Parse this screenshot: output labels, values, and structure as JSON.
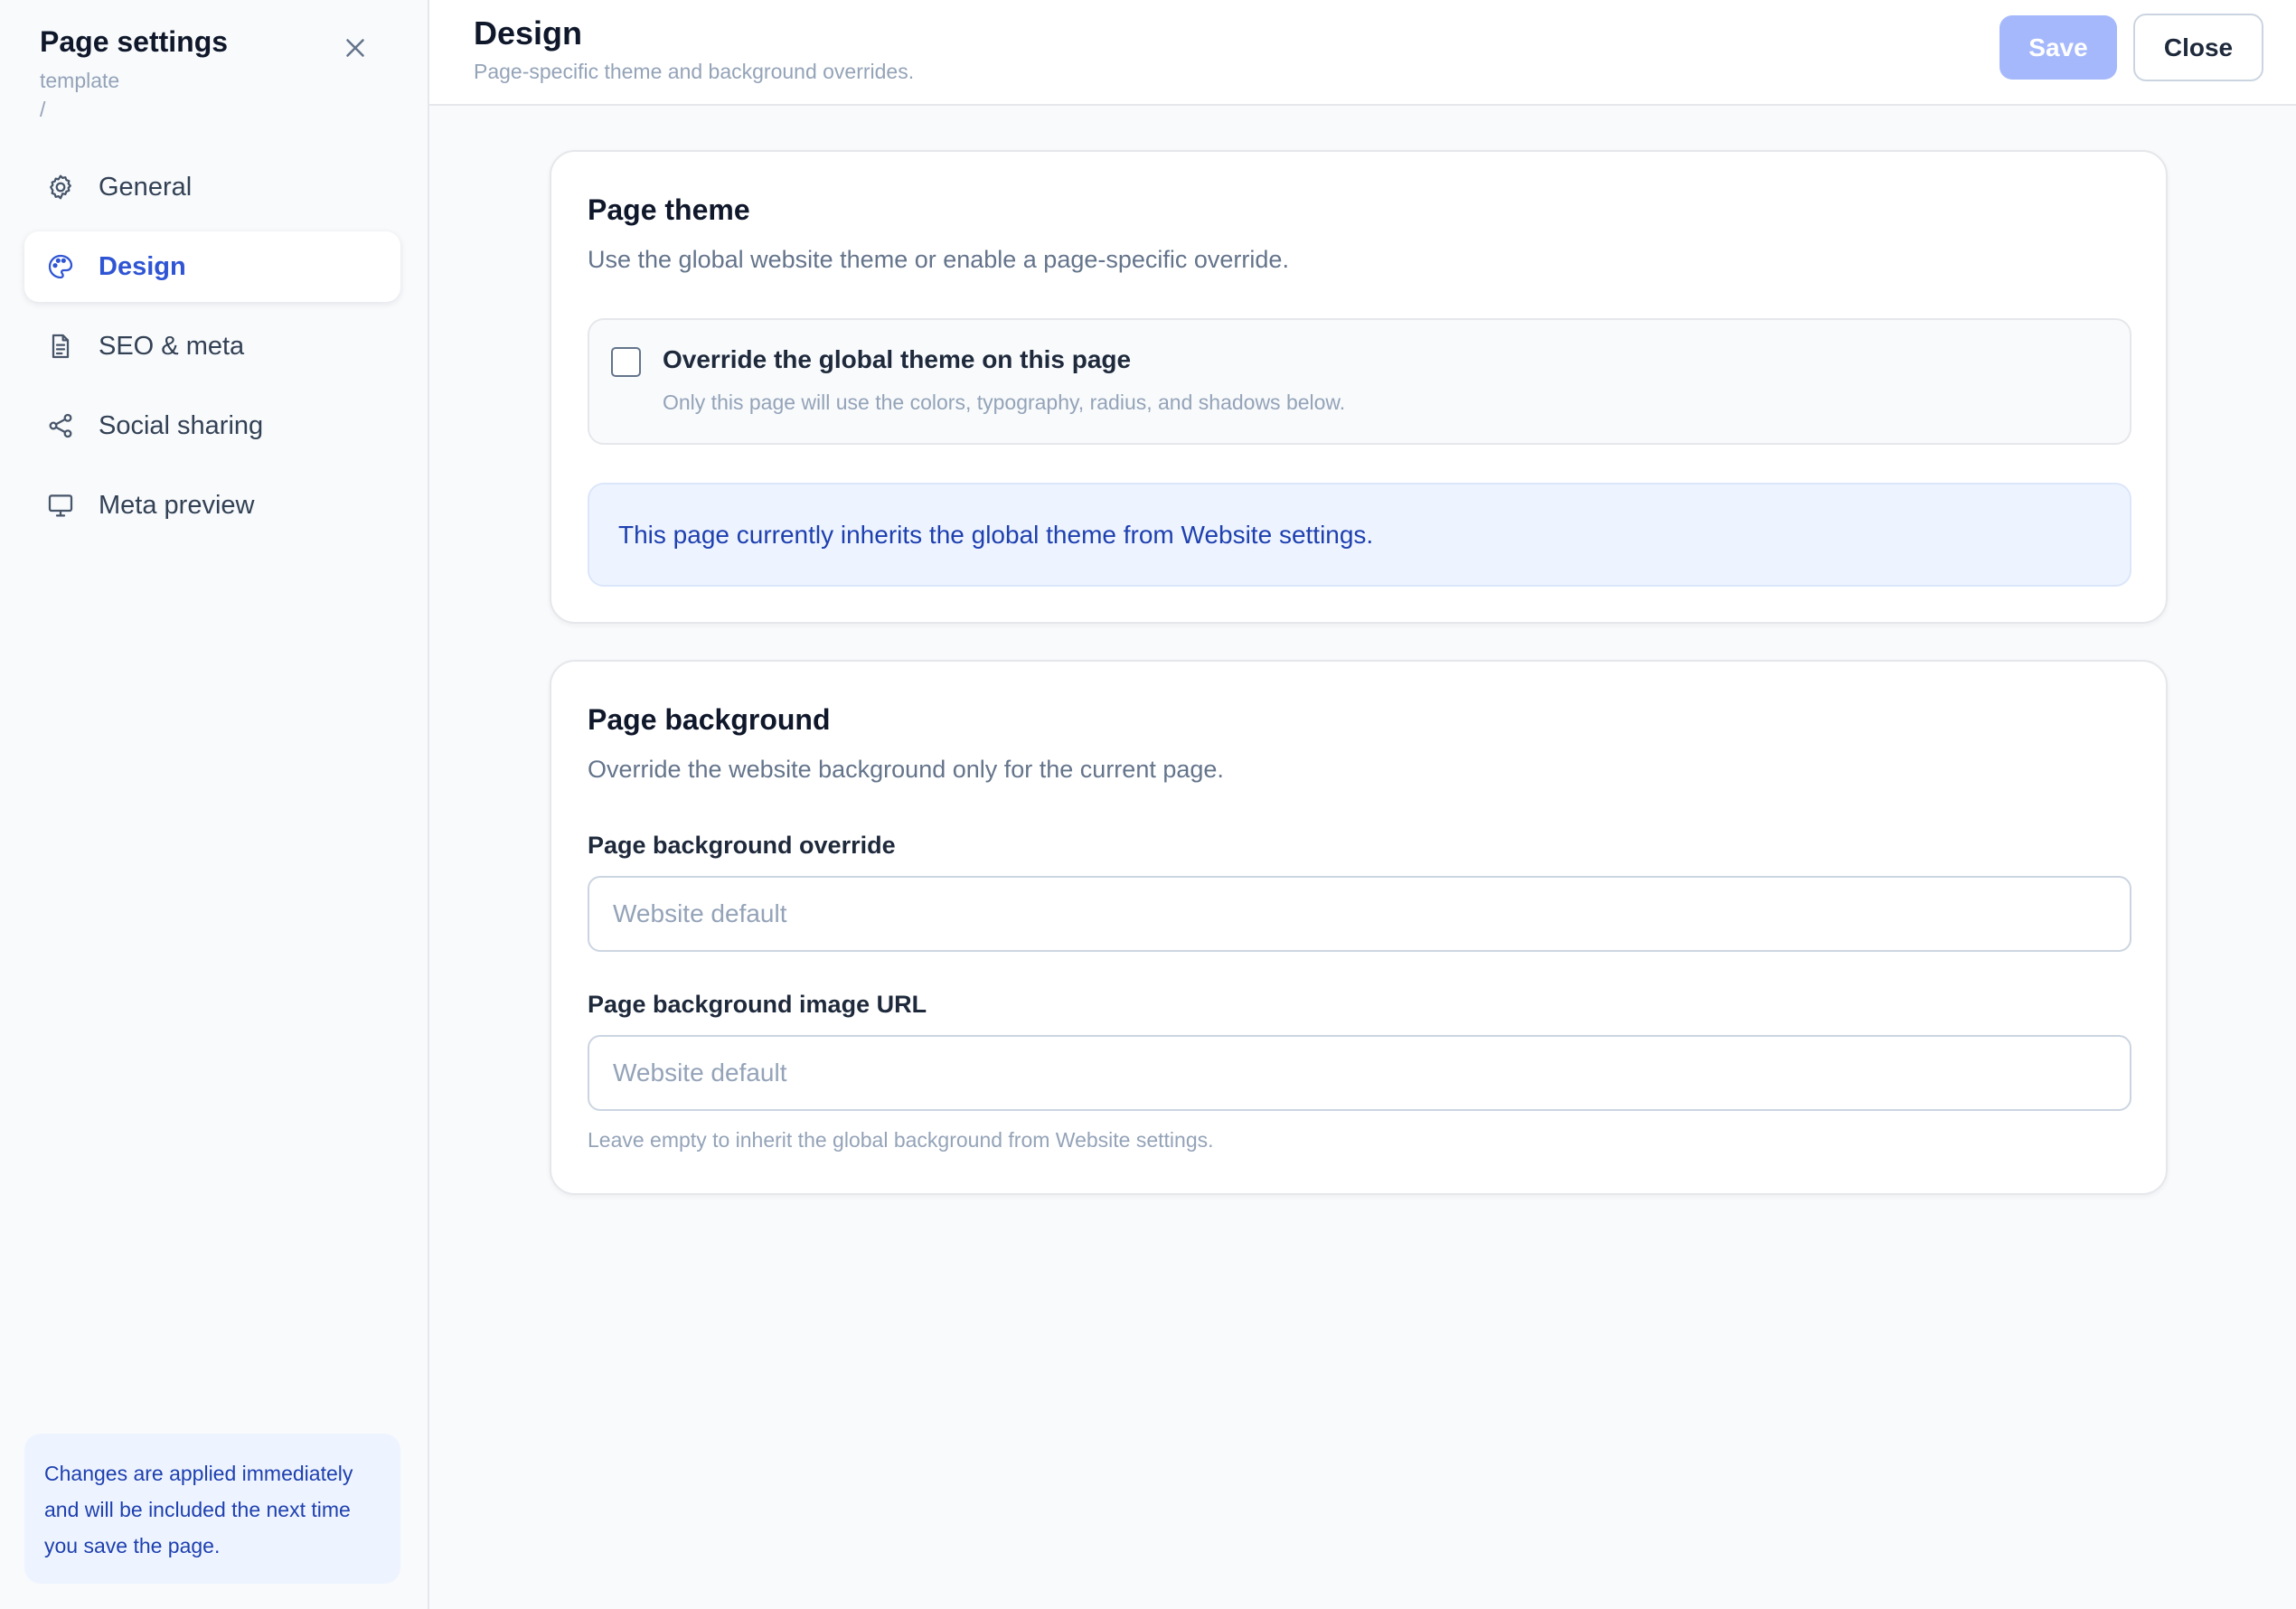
{
  "sidebar": {
    "title": "Page settings",
    "subtitle": "template",
    "path": "/",
    "close_icon": "close-icon",
    "items": [
      {
        "label": "General",
        "icon": "gear-icon",
        "active": false
      },
      {
        "label": "Design",
        "icon": "palette-icon",
        "active": true
      },
      {
        "label": "SEO & meta",
        "icon": "document-icon",
        "active": false
      },
      {
        "label": "Social sharing",
        "icon": "share-icon",
        "active": false
      },
      {
        "label": "Meta preview",
        "icon": "monitor-icon",
        "active": false
      }
    ],
    "note": "Changes are applied immediately and will be included the next time you save the page."
  },
  "header": {
    "title": "Design",
    "subtitle": "Page-specific theme and background overrides.",
    "save_label": "Save",
    "close_label": "Close"
  },
  "theme_card": {
    "title": "Page theme",
    "description": "Use the global website theme or enable a page-specific override.",
    "override_label": "Override the global theme on this page",
    "override_help": "Only this page will use the colors, typography, radius, and shadows below.",
    "override_checked": false,
    "info": "This page currently inherits the global theme from Website settings."
  },
  "background_card": {
    "title": "Page background",
    "description": "Override the website background only for the current page.",
    "bg_override_label": "Page background override",
    "bg_override_placeholder": "Website default",
    "bg_image_label": "Page background image URL",
    "bg_image_placeholder": "Website default",
    "bg_image_help": "Leave empty to inherit the global background from Website settings."
  },
  "colors": {
    "accent": "#2f55d4",
    "save_disabled": "#a5b8fb",
    "info_bg": "#eef4ff",
    "info_text": "#1e40af"
  }
}
